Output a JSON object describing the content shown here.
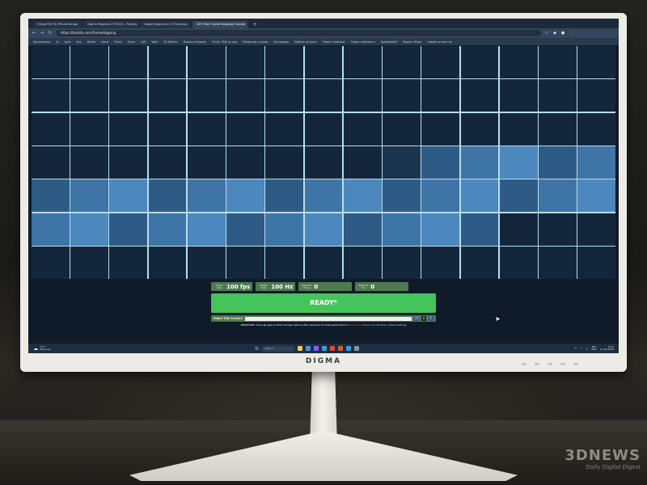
{
  "browser": {
    "tabs": [
      {
        "label": "Обзор Full HD IPS-монитора",
        "active": false
      },
      {
        "label": "Digma Progress 27P302Q - Яндекс",
        "active": false
      },
      {
        "label": "Характеристики 27 Монитор",
        "active": false
      },
      {
        "label": "UFO Test: Frame Skipping Checker",
        "active": true
      }
    ],
    "new_tab": "+",
    "url": "https://testufo.com/frameskipping",
    "bookmarks": [
      "Приложения",
      "AI",
      "Avito",
      "Buy",
      "Health",
      "Home",
      "Study",
      "Travel",
      "Soft",
      "Work",
      "4K Monitor",
      "Каналы Telegram",
      "Ютуб, ОМА на при",
      "Мониторы и проек",
      "Ультрашир",
      "Мебель на заказ",
      "Ремонт компьют",
      "Ремонт компьюте",
      "NoteboookM",
      "Яндекс Облак",
      "Новый каталог на"
    ]
  },
  "test": {
    "frame_rate": {
      "label": "Frame Rate",
      "value": "100 fps"
    },
    "refresh_rate": {
      "label": "Refresh Rate",
      "value": "100 Hz"
    },
    "pixels_per_frame": {
      "label": "Pixels Per Frame",
      "value": "0"
    },
    "pixels_per_sec": {
      "label": "Pixels Per Sec",
      "value": "0"
    },
    "status": "READY*",
    "share_label": "Share This Screen!",
    "notice_prefix": "IMPORTANT: Close all apps & other browser tabs & other windows for best performance!",
    "notice_warn": "Fullscreen!",
    "notice_links": [
      "Check Your Browser",
      "Reset Settings"
    ]
  },
  "grid": {
    "columns": 15,
    "rows": 7,
    "lit_cells": {
      "row_4": {
        "from_col": 11,
        "to_col": 15
      },
      "row_5": {
        "from_col": 1,
        "to_col": 15
      },
      "row_6": {
        "from_col": 1,
        "to_col": 12
      }
    }
  },
  "taskbar": {
    "weather_temp": "-3°C",
    "weather_desc": "Облачно",
    "search": "Поиск",
    "lang_top": "РУС",
    "lang_bottom": "ENG",
    "time": "8:41",
    "date": "12.04.2026"
  },
  "monitor": {
    "brand": "DIGMA"
  },
  "watermark": {
    "logo": "3DNEWS",
    "tagline": "Daily Digital Digest"
  },
  "colors": {
    "grid_lines": "#b9dcef",
    "cell_dark": "#14263b",
    "cell_lit": "#3f74a6",
    "ready_button": "#44c45a",
    "stat_box": "#4e7a4f"
  }
}
